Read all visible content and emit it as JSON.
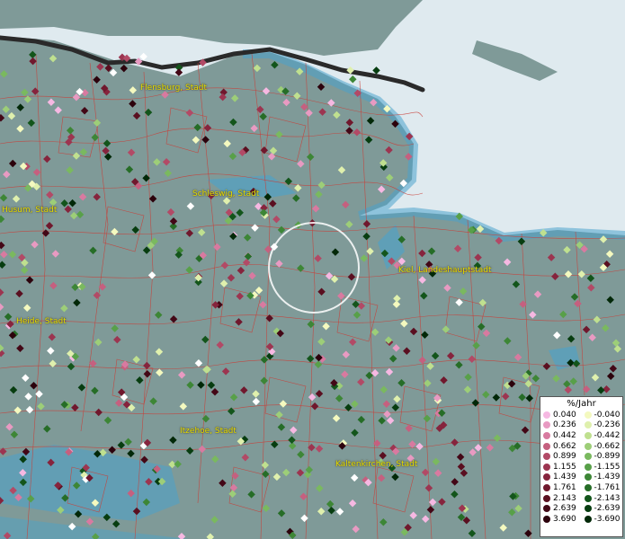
{
  "cities": [
    {
      "name": "Flensburg, Stadt"
    },
    {
      "name": "Schleswig, Stadt"
    },
    {
      "name": "Husum, Stadt"
    },
    {
      "name": "Kiel, Landeshauptstadt"
    },
    {
      "name": "Heide, Stadt"
    },
    {
      "name": "Itzehoe, Stadt"
    },
    {
      "name": "Kaltenkirchen, Stadt"
    }
  ],
  "legend": {
    "title": "%/Jahr",
    "positive": [
      {
        "value": "0.040",
        "color": "#f6b8e2"
      },
      {
        "value": "0.236",
        "color": "#e89ac2"
      },
      {
        "value": "0.442",
        "color": "#d87aa0"
      },
      {
        "value": "0.662",
        "color": "#c5607f"
      },
      {
        "value": "0.899",
        "color": "#b24a66"
      },
      {
        "value": "1.155",
        "color": "#9c3550"
      },
      {
        "value": "1.439",
        "color": "#86243d"
      },
      {
        "value": "1.761",
        "color": "#70182d"
      },
      {
        "value": "2.143",
        "color": "#5a0f20"
      },
      {
        "value": "2.639",
        "color": "#430716"
      },
      {
        "value": "3.690",
        "color": "#2c020c"
      }
    ],
    "negative": [
      {
        "value": "-0.040",
        "color": "#f4f9bf"
      },
      {
        "value": "-0.236",
        "color": "#dff0ad"
      },
      {
        "value": "-0.442",
        "color": "#bfe08f"
      },
      {
        "value": "-0.662",
        "color": "#9dce78"
      },
      {
        "value": "-0.899",
        "color": "#7ab95f"
      },
      {
        "value": "-1.155",
        "color": "#58a049"
      },
      {
        "value": "-1.439",
        "color": "#3d8636"
      },
      {
        "value": "-1.761",
        "color": "#266d27"
      },
      {
        "value": "-2.143",
        "color": "#13551b"
      },
      {
        "value": "-2.639",
        "color": "#073d10"
      },
      {
        "value": "-3.690",
        "color": "#022808"
      }
    ]
  }
}
